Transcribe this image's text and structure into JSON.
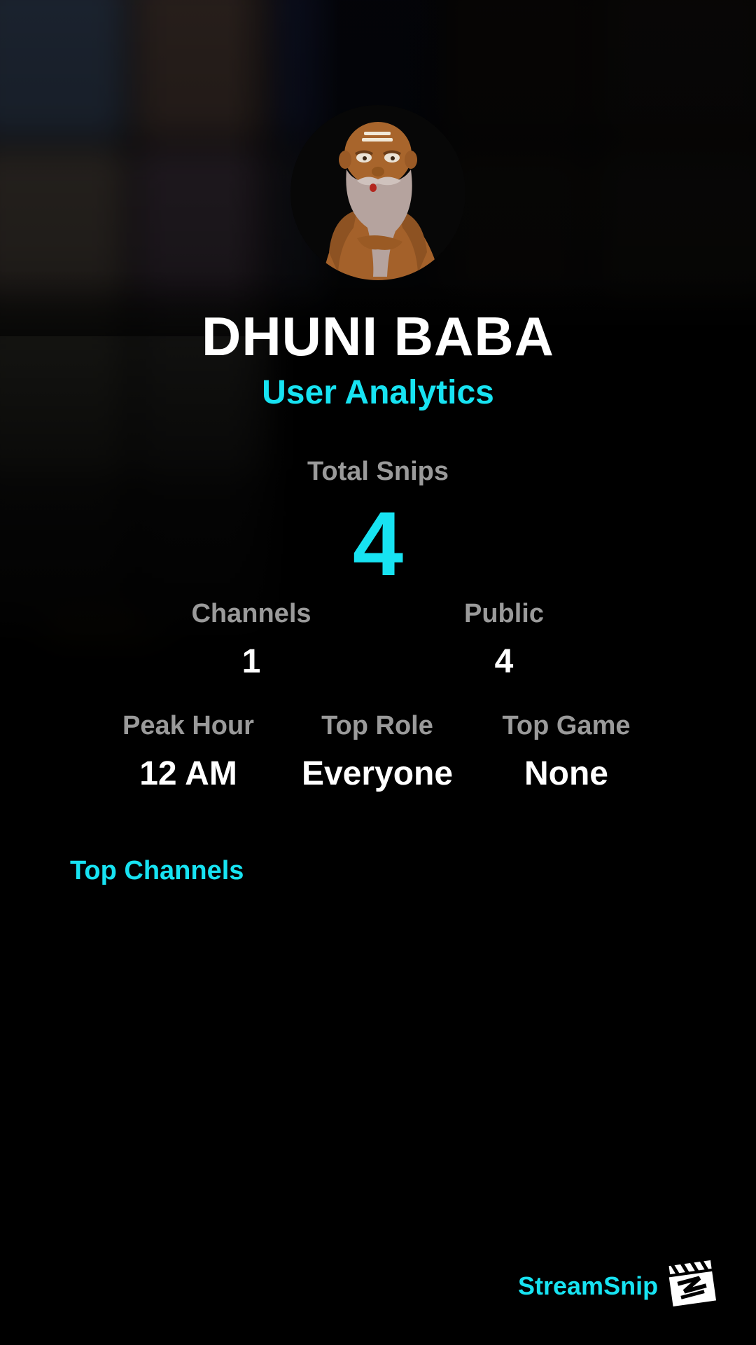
{
  "profile": {
    "username": "DHUNI BABA",
    "subtitle": "User Analytics"
  },
  "stats": {
    "total_snips": {
      "label": "Total Snips",
      "value": "4"
    },
    "channels": {
      "label": "Channels",
      "value": "1"
    },
    "public": {
      "label": "Public",
      "value": "4"
    },
    "peak_hour": {
      "label": "Peak Hour",
      "value": "12 AM"
    },
    "top_role": {
      "label": "Top Role",
      "value": "Everyone"
    },
    "top_game": {
      "label": "Top Game",
      "value": "None"
    }
  },
  "sections": {
    "top_channels_title": "Top Channels"
  },
  "brand": {
    "name": "StreamSnip",
    "icon": "clapperboard-logo-icon"
  },
  "colors": {
    "accent": "#17e3f2",
    "background": "#000000",
    "label": "#9a9a9a",
    "text": "#ffffff"
  }
}
